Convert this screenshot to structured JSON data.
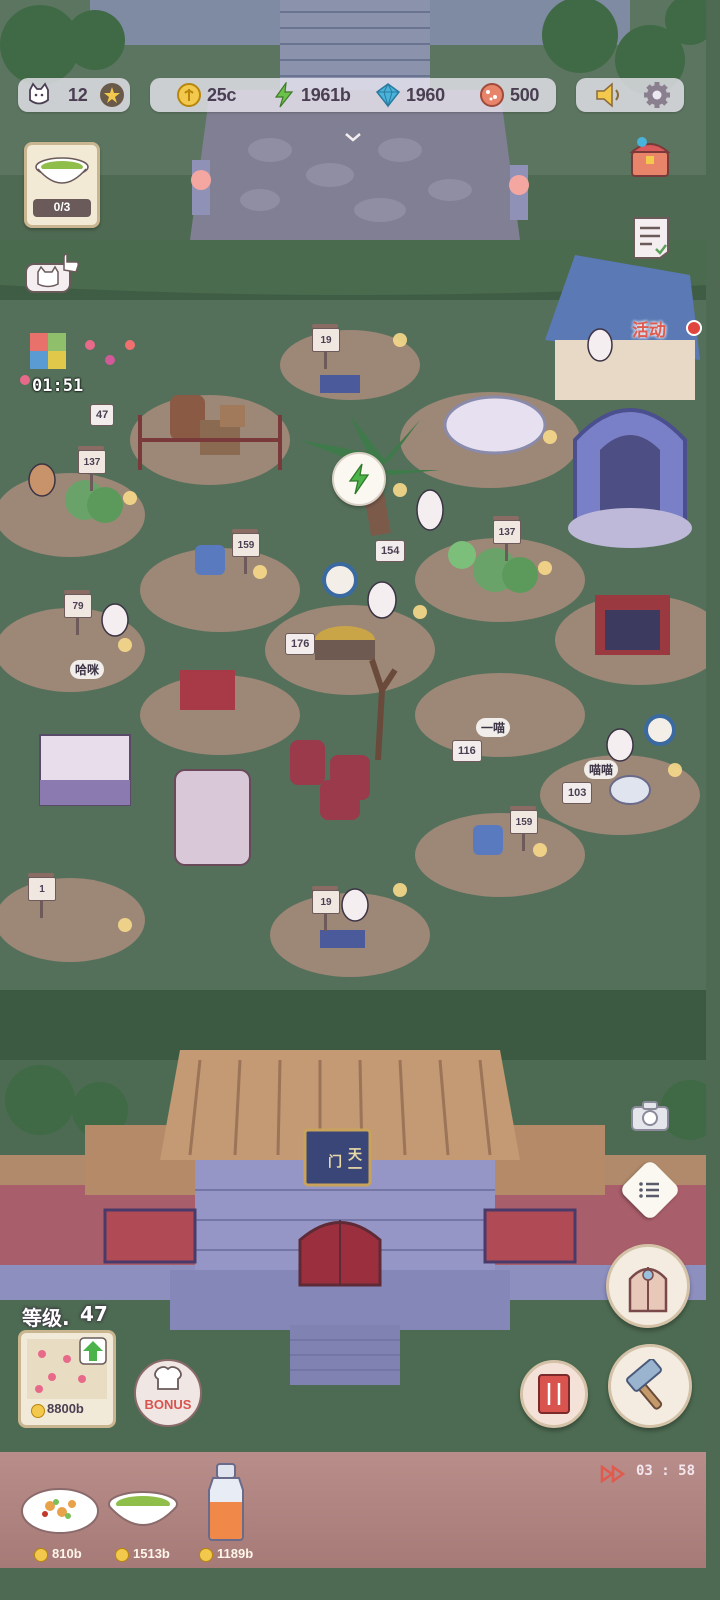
{
  "hud": {
    "cats_count": "12",
    "coins": "25c",
    "energy": "1961b",
    "gems": "1960",
    "tickets": "500"
  },
  "order_card": {
    "progress": "0/3"
  },
  "event_timer": "01:51",
  "event_label": "活动",
  "plots": {
    "sign_19_top": "19",
    "sign_47": "47",
    "sign_137_left": "137",
    "sign_159_mid": "159",
    "sign_154": "154",
    "sign_137_right": "137",
    "sign_79": "79",
    "sign_176": "176",
    "sign_116": "116",
    "sign_103": "103",
    "sign_159_low": "159",
    "sign_1": "1",
    "sign_19_bottom": "19"
  },
  "bubbles": {
    "left": "哈咪",
    "mid": "一喵",
    "right": "喵喵"
  },
  "gate_sign": "天一门",
  "level": {
    "label": "等级.",
    "value": "47"
  },
  "upgrade_price": "8800b",
  "bonus_label": "BONUS",
  "countdown": "03 : 58",
  "bottom_items": [
    {
      "name": "salad",
      "price": "810b"
    },
    {
      "name": "soup",
      "price": "1513b"
    },
    {
      "name": "juice",
      "price": "1189b"
    }
  ],
  "colors": {
    "grass": "#4f6a52",
    "path": "#a88a78",
    "roof": "#b08a6a",
    "gate_wall": "#8e8fc0",
    "accent_red": "#e05a4e"
  }
}
